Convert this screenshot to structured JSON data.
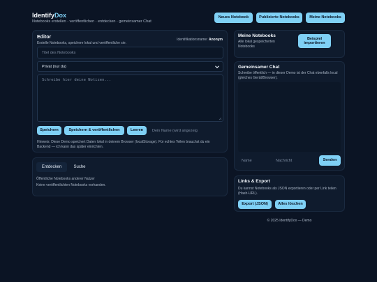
{
  "header": {
    "brand_main": "Identify",
    "brand_accent": "Dox",
    "subtitle": "Notebooks erstellen · veröffentlichen · entdecken · gemeinsamer Chat",
    "nav": {
      "new_notebook": "Neues Notebook",
      "published": "Publizierte Notebooks",
      "my_notebooks": "Meine Notebooks"
    }
  },
  "editor": {
    "title": "Editor",
    "subtitle": "Erstelle Notebooks, speichere lokal und veröffentliche sie.",
    "id_label": "Identifikationsname:",
    "id_value": "Anonym",
    "title_placeholder": "Titel des Notebooks",
    "visibility_selected": "Privat (nur du)",
    "notes_placeholder": "Schreibe hier deine Notizen...",
    "save_label": "Speichern",
    "save_publish_label": "Speichern & veröffentlichen",
    "clear_label": "Leeren",
    "name_hint": "Dein Name (wird angezeig",
    "notice": "Hinweis: Diese Demo speichert Daten lokal in deinem Browser (localStorage). Für echtes Teilen brauchst du ein Backend — ich kann das später einrichten."
  },
  "discover": {
    "tab_discover": "Entdecken",
    "tab_search": "Suche",
    "heading": "Öffentliche Notebooks anderer Nutzer",
    "empty": "Keine veröffentlichten Notebooks vorhanden."
  },
  "my_notebooks": {
    "title": "Meine Notebooks",
    "subtitle": "Alle lokal gespeicherten Notebooks",
    "example_label": "Beispiel importieren"
  },
  "chat": {
    "title": "Gemeinsamer Chat",
    "subtitle": "Schreibe öffentlich — in dieser Demo ist der Chat ebenfalls local (gleiches Gerät/Browser).",
    "name_placeholder": "Name",
    "message_placeholder": "Nachricht",
    "send_label": "Senden"
  },
  "links": {
    "title": "Links & Export",
    "subtitle": "Du kannst Notebooks als JSON exportieren oder per Link teilen (Hash-URL).",
    "export_label": "Export (JSON)",
    "clear_all_label": "Alles löschen"
  },
  "footer": {
    "text": "© 2025 IdentifyDox — Demo"
  },
  "icons": {
    "select_arrow": "chevron-down-icon",
    "resize_handle": "resize-handle-icon"
  },
  "colors": {
    "background": "#0b1424",
    "panel": "#0f1b2d",
    "accent": "#7fd0f5",
    "button_text": "#0b1626"
  }
}
